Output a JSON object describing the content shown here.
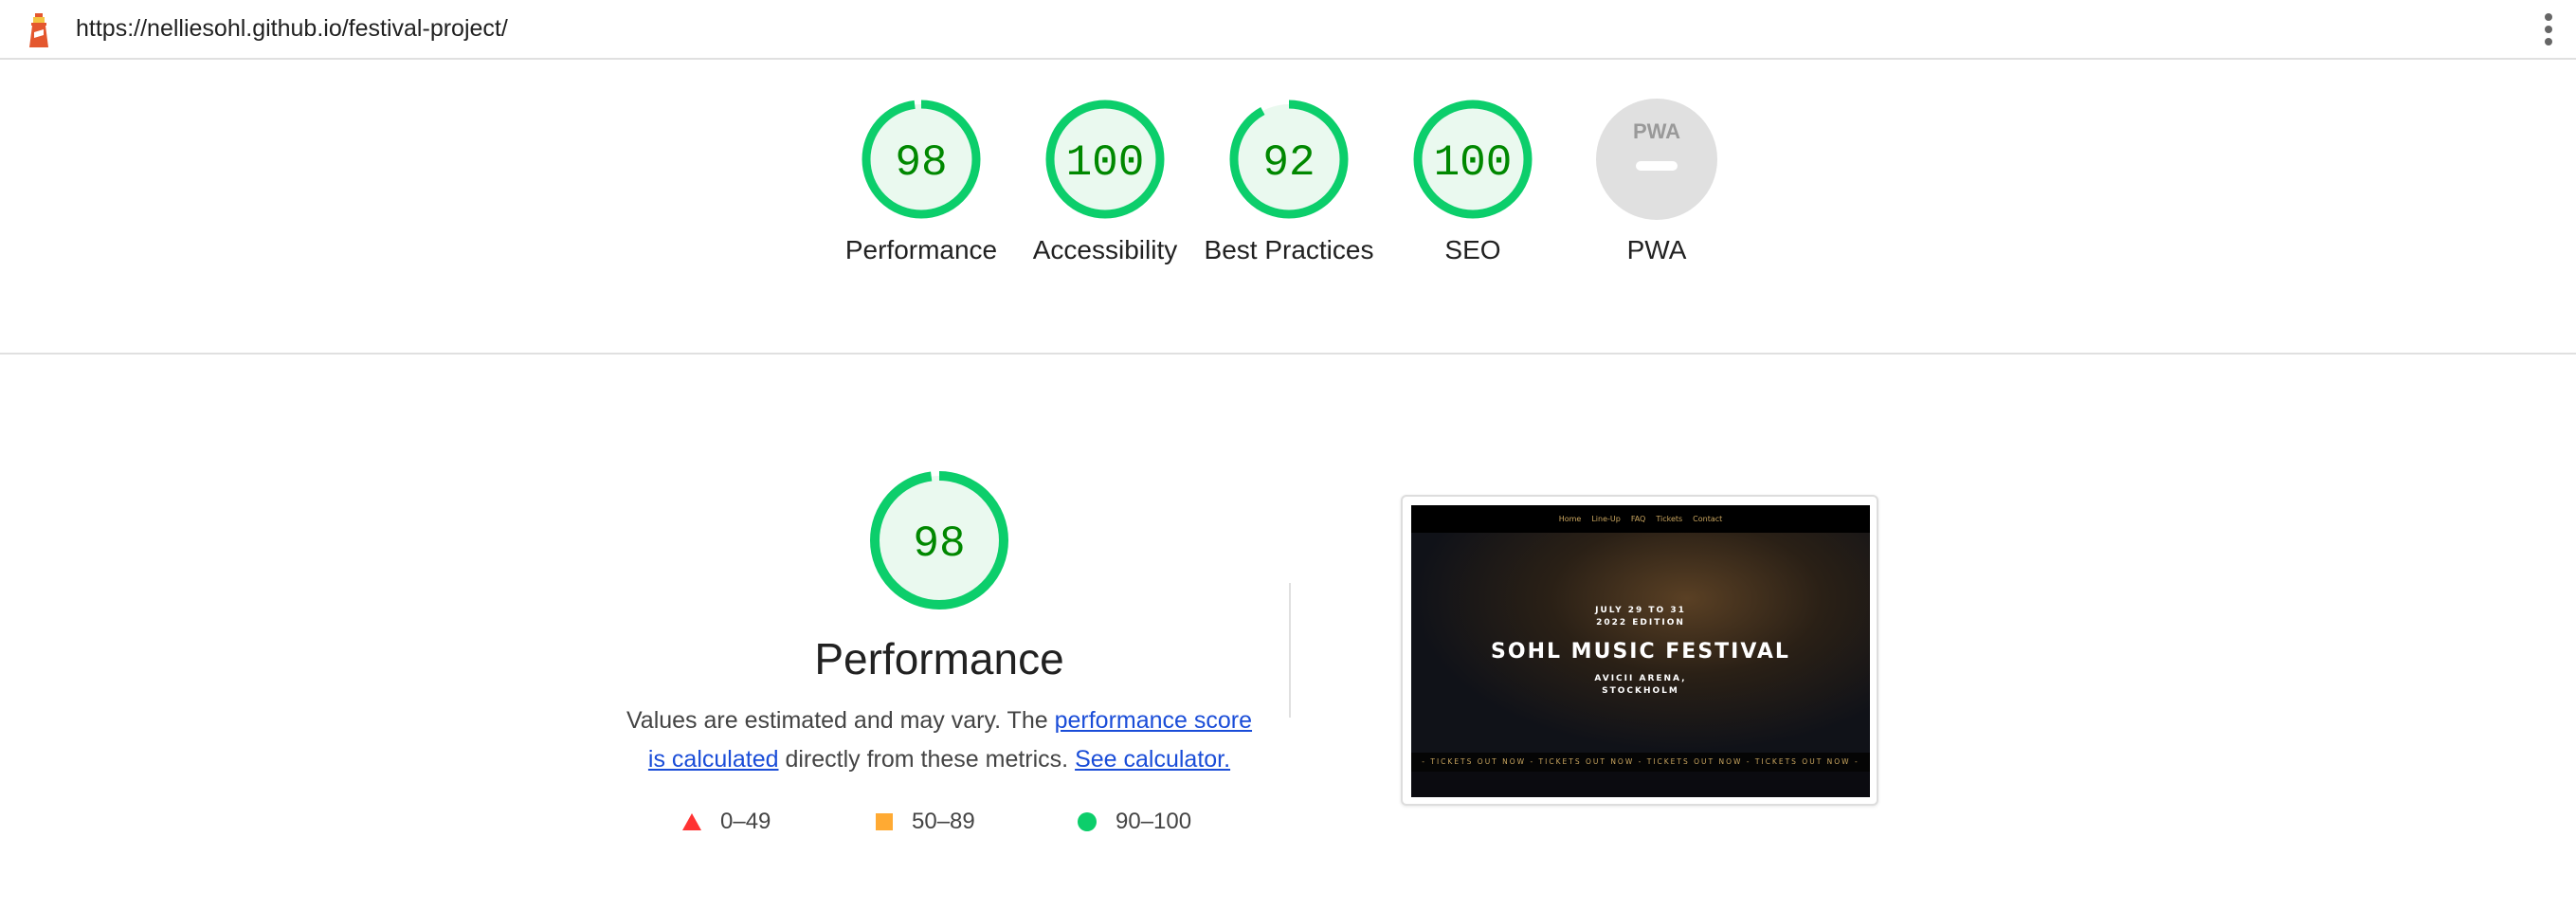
{
  "topbar": {
    "url": "https://nelliesohl.github.io/festival-project/"
  },
  "categories": [
    {
      "label": "Performance",
      "score": "98",
      "value": 98
    },
    {
      "label": "Accessibility",
      "score": "100",
      "value": 100
    },
    {
      "label": "Best Practices",
      "score": "92",
      "value": 92
    },
    {
      "label": "SEO",
      "score": "100",
      "value": 100
    },
    {
      "label": "PWA",
      "score": "",
      "value": null
    }
  ],
  "pwa_badge": "PWA",
  "performance": {
    "score": "98",
    "value": 98,
    "title": "Performance",
    "desc_pre": "Values are estimated and may vary. The ",
    "link1": "performance score is calculated",
    "desc_mid": " directly from these metrics. ",
    "link2": "See calculator."
  },
  "legend": [
    {
      "range": "0–49",
      "color": "#ff3333"
    },
    {
      "range": "50–89",
      "color": "#ffaa33"
    },
    {
      "range": "90–100",
      "color": "#0cce6b"
    }
  ],
  "screenshot": {
    "nav": [
      "Home",
      "Line-Up",
      "FAQ",
      "Tickets",
      "Contact"
    ],
    "dates": "JULY 29 TO 31",
    "edition": "2022 EDITION",
    "title": "SOHL MUSIC FESTIVAL",
    "venue1": "AVICII ARENA,",
    "venue2": "STOCKHOLM",
    "ticker": "- TICKETS OUT NOW - TICKETS OUT NOW - TICKETS OUT NOW - TICKETS OUT NOW -"
  },
  "colors": {
    "pass": "#0cce6b",
    "pass_text": "#008800",
    "pass_fill": "#eaf9ef"
  }
}
